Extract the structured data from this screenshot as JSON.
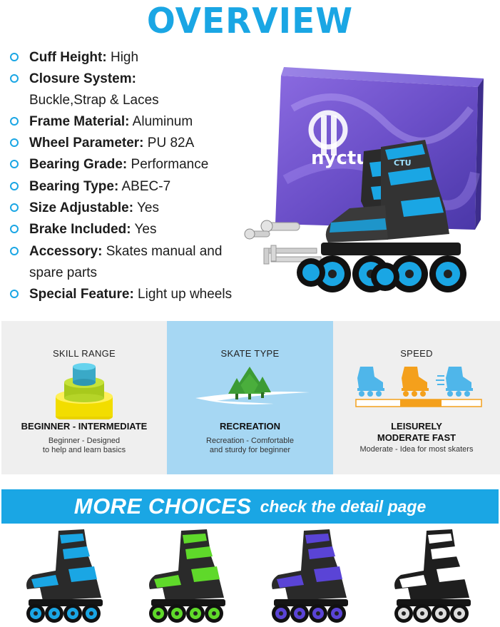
{
  "header": {
    "title": "OVERVIEW"
  },
  "specs": [
    {
      "key": "Cuff Height:",
      "value": " High"
    },
    {
      "key": "Closure System:",
      "value": "",
      "continuation": "Buckle,Strap & Laces"
    },
    {
      "key": "Frame Material:",
      "value": " Aluminum"
    },
    {
      "key": "Wheel Parameter:",
      "value": " PU 82A"
    },
    {
      "key": "Bearing Grade:",
      "value": " Performance"
    },
    {
      "key": "Bearing Type:",
      "value": " ABEC-7"
    },
    {
      "key": "Size Adjustable:",
      "value": " Yes"
    },
    {
      "key": "Brake Included:",
      "value": " Yes"
    },
    {
      "key": "Accessory:",
      "value": " Skates manual and",
      "continuation": "spare parts"
    },
    {
      "key": "Special Feature:",
      "value": " Light up wheels"
    }
  ],
  "product": {
    "box_brand": "nyctu",
    "skate_brand": "CTU",
    "accent_color": "#1aa6e4",
    "box_color": "#6b4fc8"
  },
  "features": [
    {
      "label": "SKILL RANGE",
      "icon": "stacked-cake-icon",
      "heading": "BEGINNER - INTERMEDIATE",
      "description_lines": [
        "Beginner - Designed",
        "to help and learn basics"
      ]
    },
    {
      "label": "SKATE TYPE",
      "icon": "trees-road-icon",
      "heading": "RECREATION",
      "description_lines": [
        "Recreation - Comfortable",
        "and sturdy for beginner"
      ]
    },
    {
      "label": "SPEED",
      "icon": "three-skaters-icon",
      "heading_lines": [
        "LEISURELY",
        "MODERATE FAST"
      ],
      "description_lines": [
        "Moderate - Idea for most skaters"
      ]
    }
  ],
  "more_choices": {
    "big": "MORE CHOICES",
    "small": "check the detail page",
    "variant_colors": [
      "#1aa6e4",
      "#5fd92a",
      "#5a44d6",
      "#ffffff"
    ]
  }
}
